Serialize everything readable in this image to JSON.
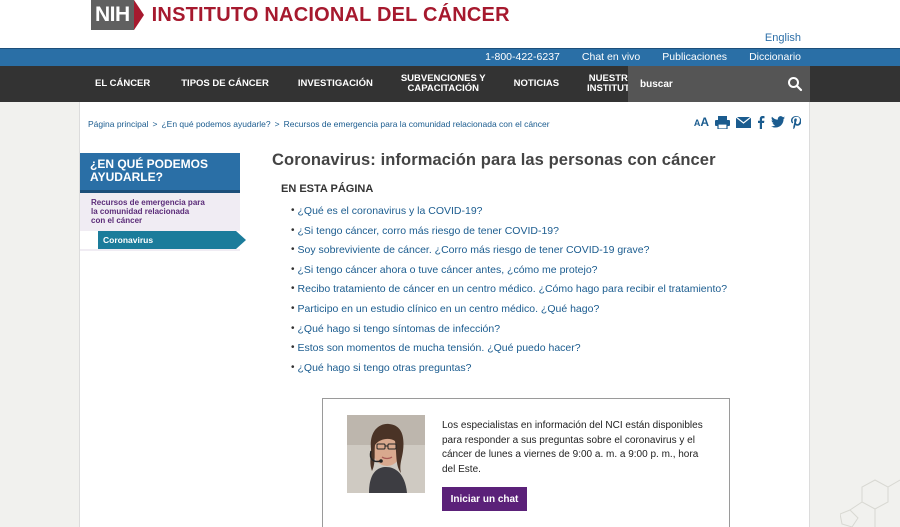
{
  "header": {
    "logo_nih": "NIH",
    "site_title": "INSTITUTO NACIONAL DEL CÁNCER",
    "language_link": "English"
  },
  "utility": {
    "phone": "1-800-422-6237",
    "chat": "Chat en vivo",
    "publications": "Publicaciones",
    "dictionary": "Diccionario"
  },
  "nav": {
    "items": [
      {
        "line1": "EL CÁNCER",
        "line2": ""
      },
      {
        "line1": "TIPOS DE CÁNCER",
        "line2": ""
      },
      {
        "line1": "INVESTIGACIÓN",
        "line2": ""
      },
      {
        "line1": "SUBVENCIONES Y",
        "line2": "CAPACITACIÓN"
      },
      {
        "line1": "NOTICIAS",
        "line2": ""
      },
      {
        "line1": "NUESTRO",
        "line2": "INSTITUTO"
      }
    ],
    "search_placeholder": "buscar"
  },
  "breadcrumb": {
    "items": [
      "Página principal",
      "¿En qué podemos ayudarle?",
      "Recursos de emergencia para la comunidad relacionada con el cáncer"
    ],
    "separator": ">"
  },
  "tools": {
    "font_size_label": "AA"
  },
  "sidebar": {
    "heading_line1": "¿EN QUÉ PODEMOS",
    "heading_line2": "AYUDARLE?",
    "sub_line1": "Recursos de emergencia para",
    "sub_line2": "la comunidad relacionada",
    "sub_line3": "con el cáncer",
    "active_item": "Coronavirus"
  },
  "main": {
    "title": "Coronavirus: información para las personas con cáncer",
    "section_label": "EN ESTA PÁGINA",
    "bullet": "•",
    "toc": [
      "¿Qué es el coronavirus y la COVID-19?",
      "¿Si tengo cáncer, corro más riesgo de tener COVID-19?",
      "Soy sobreviviente de cáncer. ¿Corro más riesgo de tener COVID-19 grave?",
      "¿Si tengo cáncer ahora o tuve cáncer antes, ¿cómo me protejo?",
      "Recibo tratamiento de cáncer en un centro médico. ¿Cómo hago para recibir el tratamiento?",
      "Participo en un estudio clínico en un centro médico. ¿Qué hago?",
      "¿Qué hago si tengo síntomas de infección?",
      "Estos son momentos de mucha tensión. ¿Qué puedo hacer?",
      "¿Qué hago si tengo otras preguntas?"
    ]
  },
  "chat_box": {
    "text": "Los especialistas en información del NCI están disponibles para responder a sus preguntas sobre el coronavirus y el cáncer de lunes a viernes de 9:00 a. m. a 9:00 p. m., hora del Este.",
    "button_label": "Iniciar un chat"
  },
  "colors": {
    "brand_red": "#a6192e",
    "utility_blue": "#2a6fa6",
    "nav_dark": "#333333",
    "link_blue": "#1b5c8f",
    "sidebar_purple": "#5b2c79",
    "active_teal": "#1b7c9b",
    "chat_button_purple": "#5b2179"
  },
  "icons": [
    "search-icon",
    "font-size-icon",
    "print-icon",
    "email-icon",
    "facebook-icon",
    "twitter-icon",
    "pinterest-icon"
  ]
}
